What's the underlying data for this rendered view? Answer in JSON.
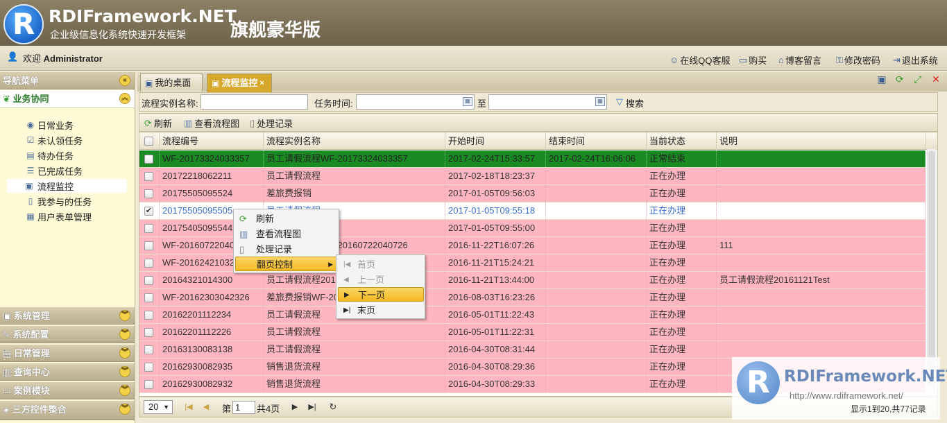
{
  "header": {
    "brand": "RDIFramework.NET",
    "subtitle": "企业级信息化系统快速开发框架",
    "edition": "旗舰豪华版",
    "logo_letter": "R"
  },
  "userbar": {
    "welcome_prefix": "欢迎 ",
    "user": "Administrator",
    "links": [
      {
        "label": "在线QQ客服",
        "icon": "user-support-icon"
      },
      {
        "label": "购买",
        "icon": "cart-icon"
      },
      {
        "label": "博客留言",
        "icon": "home-icon"
      },
      {
        "label": "修改密码",
        "icon": "key-icon"
      },
      {
        "label": "退出系统",
        "icon": "exit-icon"
      }
    ]
  },
  "sidebar": {
    "title": "导航菜单",
    "section": "业务协同",
    "items": [
      {
        "label": "日常业务",
        "icon": "globe-icon"
      },
      {
        "label": "未认领任务",
        "icon": "task-icon"
      },
      {
        "label": "待办任务",
        "icon": "inbox-icon"
      },
      {
        "label": "已完成任务",
        "icon": "list-icon"
      },
      {
        "label": "流程监控",
        "icon": "monitor-icon",
        "selected": true
      },
      {
        "label": "我参与的任务",
        "icon": "doc-icon"
      },
      {
        "label": "用户表单管理",
        "icon": "form-icon"
      }
    ],
    "groups": [
      "系统管理",
      "系统配置",
      "日常管理",
      "查询中心",
      "案例模块",
      "三方控件整合"
    ]
  },
  "tabs": [
    {
      "label": "我的桌面",
      "active": false
    },
    {
      "label": "流程监控",
      "active": true,
      "close": "×"
    }
  ],
  "filter": {
    "name_label": "流程实例名称:",
    "time_label": "任务时间:",
    "to_label": "至",
    "search_label": "搜索",
    "name_value": "",
    "start_value": "",
    "end_value": ""
  },
  "toolbar": {
    "refresh": "刷新",
    "view_chart": "查看流程图",
    "history": "处理记录"
  },
  "grid": {
    "columns": [
      "流程编号",
      "流程实例名称",
      "开始时间",
      "结束时间",
      "当前状态",
      "说明"
    ],
    "rows": [
      {
        "id": "WF-20173324033357",
        "name": "员工请假流程WF-20173324033357",
        "start": "2017-02-24T15:33:57",
        "end": "2017-02-24T16:06:06",
        "status": "正常结束",
        "note": "",
        "style": "green"
      },
      {
        "id": "20172218062211",
        "name": "员工请假流程",
        "start": "2017-02-18T18:23:37",
        "end": "",
        "status": "正在办理",
        "note": "",
        "style": "pink"
      },
      {
        "id": "20175505095524",
        "name": "差旅费报销",
        "start": "2017-01-05T09:56:03",
        "end": "",
        "status": "正在办理",
        "note": "",
        "style": "pink"
      },
      {
        "id": "20175505095505",
        "name": "员工请假流程",
        "start": "2017-01-05T09:55:18",
        "end": "",
        "status": "正在办理",
        "note": "",
        "style": "blue",
        "checked": true
      },
      {
        "id": "20175405095544",
        "name": "",
        "start": "2017-01-05T09:55:00",
        "end": "",
        "status": "正在办理",
        "note": "",
        "style": "pink"
      },
      {
        "id": "WF-20160722040726",
        "name": "员工请假流程WF-20160722040726",
        "start": "2016-11-22T16:07:26",
        "end": "",
        "status": "正在办理",
        "note": "111",
        "style": "pink"
      },
      {
        "id": "WF-20162421032421",
        "name": "",
        "start": "2016-11-21T15:24:21",
        "end": "",
        "status": "正在办理",
        "note": "",
        "style": "pink"
      },
      {
        "id": "20164321014300",
        "name": "员工请假流程20161121Test",
        "start": "2016-11-21T13:44:00",
        "end": "",
        "status": "正在办理",
        "note": "员工请假流程20161121Test",
        "style": "pink"
      },
      {
        "id": "WF-20162303042326",
        "name": "差旅费报销WF-20162303042326",
        "start": "2016-08-03T16:23:26",
        "end": "",
        "status": "正在办理",
        "note": "",
        "style": "pink"
      },
      {
        "id": "20162201112234",
        "name": "员工请假流程",
        "start": "2016-05-01T11:22:43",
        "end": "",
        "status": "正在办理",
        "note": "",
        "style": "pink"
      },
      {
        "id": "20162201112226",
        "name": "员工请假流程",
        "start": "2016-05-01T11:22:31",
        "end": "",
        "status": "正在办理",
        "note": "",
        "style": "pink"
      },
      {
        "id": "20163130083138",
        "name": "员工请假流程",
        "start": "2016-04-30T08:31:44",
        "end": "",
        "status": "正在办理",
        "note": "",
        "style": "pink"
      },
      {
        "id": "20162930082935",
        "name": "销售退货流程",
        "start": "2016-04-30T08:29:36",
        "end": "",
        "status": "正在办理",
        "note": "",
        "style": "pink"
      },
      {
        "id": "20162930082932",
        "name": "销售退货流程",
        "start": "2016-04-30T08:29:33",
        "end": "",
        "status": "正在办理",
        "note": "",
        "style": "pink"
      }
    ]
  },
  "context_menu": {
    "items": [
      "刷新",
      "查看流程图",
      "处理记录",
      "翻页控制"
    ],
    "submenu": [
      "首页",
      "上一页",
      "下一页",
      "末页"
    ]
  },
  "pager": {
    "page_size": "20",
    "page_label": "第",
    "page_value": "1",
    "total_pages": "共4页",
    "records": "显示1到20,共77记录"
  },
  "watermark": {
    "brand": "RDIFramework.NET",
    "url": "http://www.rdiframework.net/",
    "letter": "R"
  },
  "colors": {
    "accent": "#d6a92c",
    "pink_row": "#ffb6c1",
    "green_row": "#1a8a23",
    "highlight": "#f2b924"
  }
}
